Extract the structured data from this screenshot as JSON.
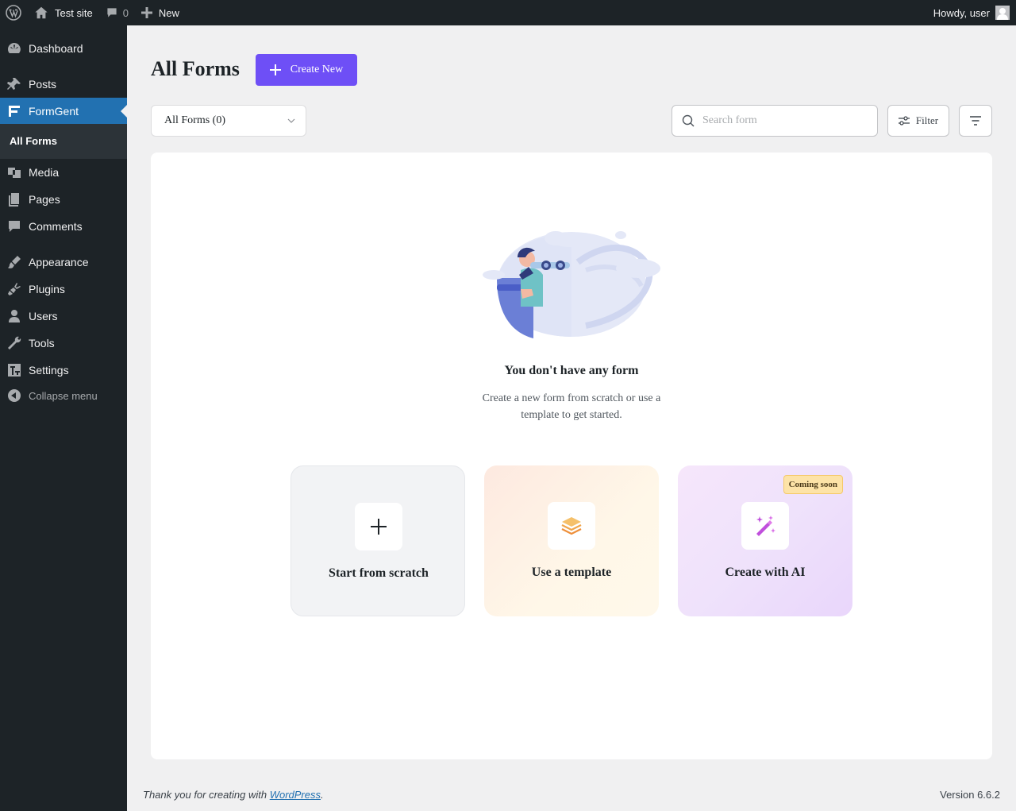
{
  "admin_bar": {
    "site_name": "Test site",
    "comments_count": "0",
    "new_label": "New",
    "howdy": "Howdy, user"
  },
  "sidebar": {
    "items": [
      {
        "label": "Dashboard",
        "icon": "dashboard-icon"
      },
      {
        "label": "Posts",
        "icon": "pin-icon"
      },
      {
        "label": "FormGent",
        "icon": "formgent-icon"
      },
      {
        "label": "Media",
        "icon": "media-icon"
      },
      {
        "label": "Pages",
        "icon": "pages-icon"
      },
      {
        "label": "Comments",
        "icon": "comment-icon"
      },
      {
        "label": "Appearance",
        "icon": "brush-icon"
      },
      {
        "label": "Plugins",
        "icon": "plug-icon"
      },
      {
        "label": "Users",
        "icon": "user-icon"
      },
      {
        "label": "Tools",
        "icon": "wrench-icon"
      },
      {
        "label": "Settings",
        "icon": "settings-icon"
      }
    ],
    "submenu_active": "All Forms",
    "collapse_label": "Collapse menu",
    "active_color": "#2271b1"
  },
  "header": {
    "title": "All Forms",
    "create_button": "Create New",
    "accent": "#6e4ff6"
  },
  "toolbar": {
    "select_value": "All Forms (0)",
    "search_placeholder": "Search form",
    "filter_label": "Filter"
  },
  "empty_state": {
    "title": "You don't have any form",
    "description": "Create a new form from scratch or use a template to get started."
  },
  "cards": [
    {
      "label": "Start from scratch",
      "icon": "plus-icon"
    },
    {
      "label": "Use a template",
      "icon": "layers-icon"
    },
    {
      "label": "Create with AI",
      "icon": "magic-wand-icon",
      "badge": "Coming soon"
    }
  ],
  "footer": {
    "thanks_prefix": "Thank you for creating with",
    "wordpress_link": "WordPress",
    "version": "Version 6.6.2"
  }
}
